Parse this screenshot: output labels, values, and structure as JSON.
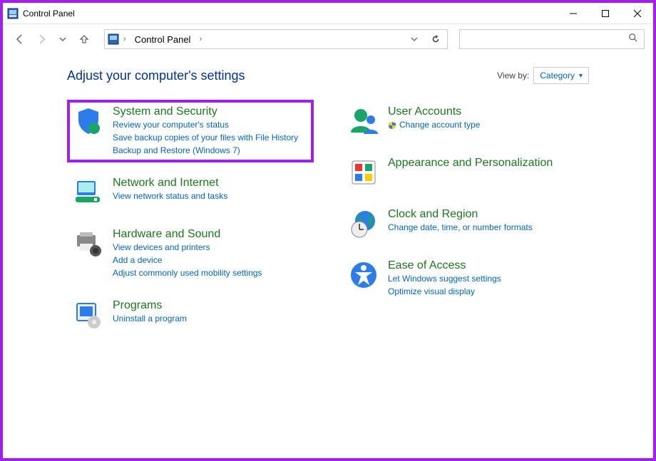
{
  "window": {
    "title": "Control Panel"
  },
  "addressbar": {
    "crumb1": "Control Panel",
    "separator": "›"
  },
  "content": {
    "heading": "Adjust your computer's settings",
    "viewby_label": "View by:",
    "viewby_value": "Category"
  },
  "categories": {
    "system_security": {
      "title": "System and Security",
      "links": [
        "Review your computer's status",
        "Save backup copies of your files with File History",
        "Backup and Restore (Windows 7)"
      ]
    },
    "network": {
      "title": "Network and Internet",
      "links": [
        "View network status and tasks"
      ]
    },
    "hardware": {
      "title": "Hardware and Sound",
      "links": [
        "View devices and printers",
        "Add a device",
        "Adjust commonly used mobility settings"
      ]
    },
    "programs": {
      "title": "Programs",
      "links": [
        "Uninstall a program"
      ]
    },
    "users": {
      "title": "User Accounts",
      "links": [
        "Change account type"
      ],
      "shielded": [
        true
      ]
    },
    "appearance": {
      "title": "Appearance and Personalization",
      "links": []
    },
    "clock": {
      "title": "Clock and Region",
      "links": [
        "Change date, time, or number formats"
      ]
    },
    "ease": {
      "title": "Ease of Access",
      "links": [
        "Let Windows suggest settings",
        "Optimize visual display"
      ]
    }
  }
}
